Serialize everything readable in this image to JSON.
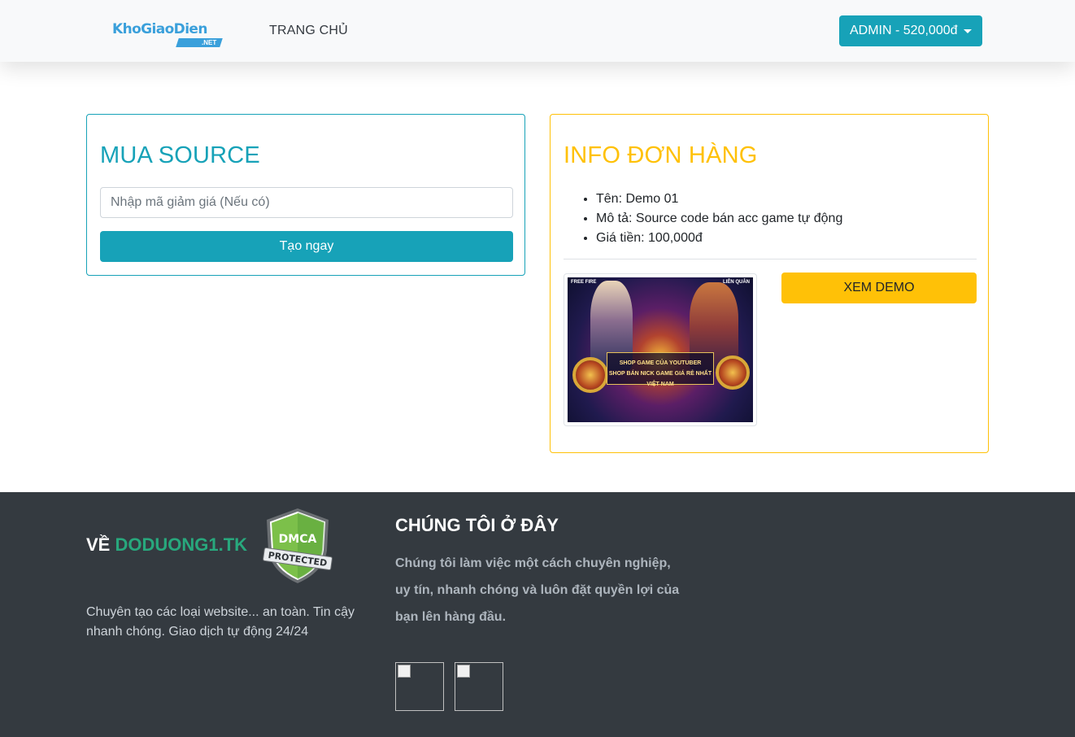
{
  "navbar": {
    "logo_text": "KhoGiaoDien",
    "logo_tag": ".NET",
    "home_label": "TRANG CHỦ",
    "user_menu_label": "ADMIN - 520,000đ"
  },
  "buy_card": {
    "title": "MUA SOURCE",
    "coupon_placeholder": "Nhập mã giảm giá (Nếu có)",
    "coupon_value": "",
    "submit_label": "Tạo ngay",
    "accent_color": "#17a2b8"
  },
  "info_card": {
    "title": "INFO ĐƠN HÀNG",
    "items": [
      "Tên: Demo 01",
      "Mô tả: Source code bán acc game tự động",
      "Giá tiền: 100,000đ"
    ],
    "thumbnail": {
      "banner_line1": "SHOP GAME CỦA YOUTUBER",
      "banner_line2": "SHOP BÁN NICK GAME GIÁ RẺ NHẤT VIỆT NAM",
      "brand_left": "FREE FIRE",
      "brand_right": "LIÊN QUÂN"
    },
    "demo_label": "XEM DEMO",
    "accent_color": "#ffc107"
  },
  "footer": {
    "about_prefix": "VỀ",
    "about_site": "DODUONG1.TK",
    "dmca_badge_top": "DMCA",
    "dmca_badge_bottom": "PROTECTED",
    "about_text": "Chuyên tạo các loại website... an toàn. Tin cậy nhanh chóng. Giao dịch tự động 24/24",
    "we_title": "CHÚNG TÔI Ở ĐÂY",
    "we_text": "Chúng tôi làm việc một cách chuyên nghiệp, uy tín, nhanh chóng và luôn đặt quyền lợi của bạn lên hàng đầu.",
    "background_color": "#343a40"
  }
}
